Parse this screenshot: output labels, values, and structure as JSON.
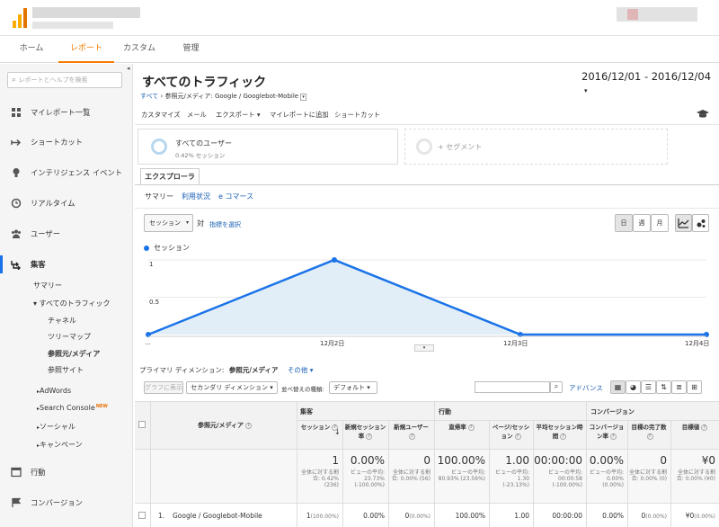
{
  "nav": {
    "home": "ホーム",
    "reports": "レポート",
    "custom": "カスタム",
    "admin": "管理"
  },
  "sidebar": {
    "search_placeholder": "レポートとヘルプを検索",
    "items": [
      {
        "label": "マイレポート一覧",
        "icon": "grid-icon"
      },
      {
        "label": "ショートカット",
        "icon": "shortcut-icon"
      },
      {
        "label": "インテリジェンス イベント",
        "icon": "lightbulb-icon"
      },
      {
        "label": "リアルタイム",
        "icon": "clock-icon"
      },
      {
        "label": "ユーザー",
        "icon": "users-icon"
      },
      {
        "label": "集客",
        "icon": "acquisition-icon"
      },
      {
        "label": "行動",
        "icon": "behavior-icon"
      },
      {
        "label": "コンバージョン",
        "icon": "flag-icon"
      }
    ],
    "acq": {
      "summary": "サマリー",
      "all_traffic": "▾ すべてのトラフィック",
      "channel": "チャネル",
      "treemap": "ツリーマップ",
      "source_medium": "参照元/メディア",
      "referrals": "参照サイト",
      "adwords": "AdWords",
      "search_console": "Search Console",
      "new_badge": "NEW",
      "social": "ソーシャル",
      "campaigns": "キャンペーン"
    }
  },
  "header": {
    "title": "すべてのトラフィック",
    "bc_all": "すべて",
    "bc_rest": "› 参照元/メディア: Google / Googlebot-Mobile",
    "date": "2016/12/01 - 2016/12/04"
  },
  "toolbar": [
    "カスタマイズ",
    "メール",
    "エクスポート ▾",
    "マイレポートに追加",
    "ショートカット"
  ],
  "segments": {
    "all_users": "すべてのユーザー",
    "all_users_sub": "0.42% セッション",
    "add": "+ セグメント"
  },
  "explorer": {
    "tab": "エクスプローラ",
    "subtabs": [
      "サマリー",
      "利用状況",
      "e コマース"
    ]
  },
  "controls": {
    "metric": "セッション",
    "vs": "対",
    "select_metric": "指標を選択",
    "day": "日",
    "week": "週",
    "month": "月"
  },
  "chart_data": {
    "type": "line",
    "categories": [
      "12月1日",
      "12月2日",
      "12月3日",
      "12月4日"
    ],
    "series": [
      {
        "name": "セッション",
        "values": [
          0,
          1,
          0,
          0
        ]
      }
    ],
    "yticks": [
      "1",
      "0.5"
    ],
    "xtick_labels": [
      "...",
      "12月2日",
      "12月3日",
      "12月4日"
    ],
    "ylim": [
      0,
      1
    ],
    "color": "#1a73e8"
  },
  "dims": {
    "label": "プライマリ ディメンション:",
    "value": "参照元/メディア",
    "other": "その他 ▾"
  },
  "table_ctrl": {
    "graph": "グラフに表示",
    "secondary": "セカンダリ ディメンション ▾",
    "sort": "並べ替えの種類:",
    "default": "デフォルト ▾",
    "advanced": "アドバンス"
  },
  "table": {
    "group_acq": "集客",
    "group_beh": "行動",
    "group_conv": "コンバージョン",
    "dim_header": "参照元/メディア",
    "headers": [
      "セッション",
      "新規セッション率",
      "新規ユーザー",
      "直帰率",
      "ページ/セッション",
      "平均セッション時間",
      "コンバージョン率",
      "目標の完了数",
      "目標値"
    ],
    "totals": [
      {
        "big": "1",
        "small": "全体に対する割合: 0.42% (236)"
      },
      {
        "big": "0.00%",
        "small": "ビューの平均: 23.73% (-100.00%)"
      },
      {
        "big": "0",
        "small": "全体に対する割合: 0.00% (56)"
      },
      {
        "big": "100.00%",
        "small": "ビューの平均: 80.93% (23.56%)"
      },
      {
        "big": "1.00",
        "small": "ビューの平均: 1.30 (-23.13%)"
      },
      {
        "big": "00:00:00",
        "small": "ビューの平均: 00:00:58 (-100.00%)"
      },
      {
        "big": "0.00%",
        "small": "ビューの平均: 0.00% (0.00%)"
      },
      {
        "big": "0",
        "small": "全体に対する割合: 0.00% (0)"
      },
      {
        "big": "¥0",
        "small": "全体に対する割合: 0.00% (¥0)"
      }
    ],
    "row": {
      "index": "1.",
      "name": "Google / Googlebot-Mobile",
      "values": [
        "1",
        "0.00%",
        "0",
        "100.00%",
        "1.00",
        "00:00:00",
        "0.00%",
        "0",
        "¥0"
      ],
      "pcts": [
        "(100.00%)",
        "",
        "(0.00%)",
        "",
        "",
        "",
        "",
        "(0.00%)",
        "(0.00%)"
      ]
    }
  }
}
